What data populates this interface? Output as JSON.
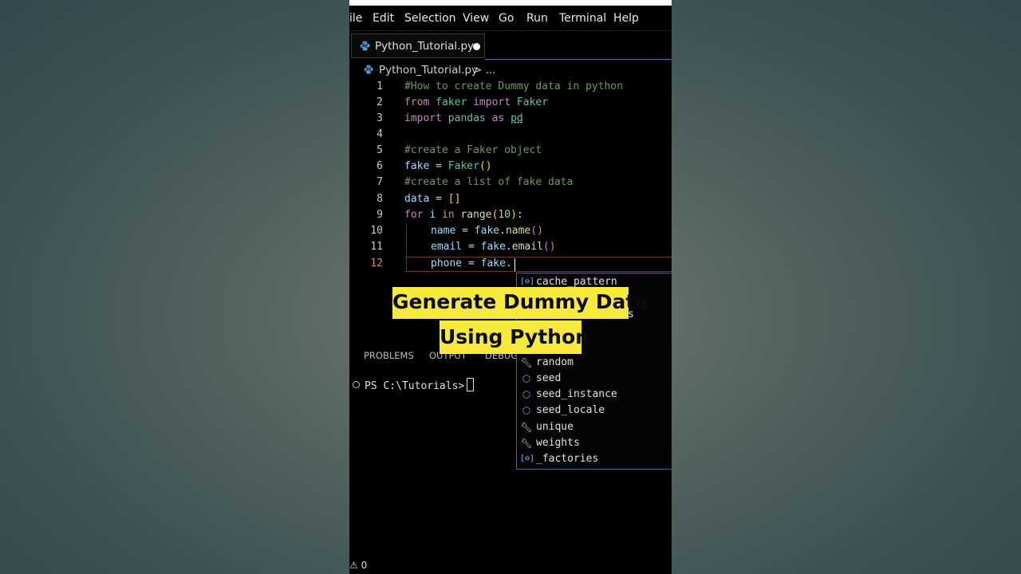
{
  "menu": [
    "ile",
    "Edit",
    "Selection",
    "View",
    "Go",
    "Run",
    "Terminal",
    "Help"
  ],
  "tab": {
    "label": "Python_Tutorial.py",
    "icon": "python-icon"
  },
  "breadcrumb": {
    "file": "Python_Tutorial.py",
    "rest": "> ..."
  },
  "line_numbers": [
    "1",
    "2",
    "3",
    "4",
    "5",
    "6",
    "7",
    "8",
    "9",
    "10",
    "11",
    "12"
  ],
  "code": {
    "l1_comment": "#How to create Dummy data in python",
    "l2_from": "from",
    "l2_module": "faker",
    "l2_import": "import",
    "l2_name": "Faker",
    "l3_import": "import",
    "l3_module": "pandas",
    "l3_as": "as",
    "l3_alias": "pd",
    "l5_comment": "#create a Faker object",
    "l6_var": "fake",
    "l6_eq": " = ",
    "l6_cls": "Faker",
    "l6_paren": "()",
    "l7_comment": "#create a list of fake data",
    "l8_var": "data",
    "l8_eq": " = ",
    "l8_brackets": "[]",
    "l9_for": "for",
    "l9_i": "i",
    "l9_in": "in",
    "l9_fn": "range",
    "l9_open": "(",
    "l9_num": "10",
    "l9_close": ")",
    "l9_colon": ":",
    "l10_var": "name",
    "l10_eq": " = ",
    "l10_obj": "fake",
    "l10_dot": ".",
    "l10_fn": "name",
    "l10_paren": "()",
    "l11_var": "email",
    "l11_eq": " = ",
    "l11_obj": "fake",
    "l11_dot": ".",
    "l11_fn": "email",
    "l11_paren": "()",
    "l12_var": "phone",
    "l12_eq": " = ",
    "l12_obj": "fake",
    "l12_dot": "."
  },
  "suggestions": [
    {
      "label": "cache_pattern",
      "icon": "field-icon"
    },
    {
      "label": "random",
      "icon": "wrench-icon"
    },
    {
      "label": "seed",
      "icon": "method-icon"
    },
    {
      "label": "seed_instance",
      "icon": "method-icon"
    },
    {
      "label": "seed_locale",
      "icon": "method-icon"
    },
    {
      "label": "unique",
      "icon": "wrench-icon"
    },
    {
      "label": "weights",
      "icon": "wrench-icon"
    },
    {
      "label": "_factories",
      "icon": "field-icon"
    }
  ],
  "hidden_suggestion_fragment": "s",
  "panel_tabs": [
    "PROBLEMS",
    "OUTPUT",
    "DEBUG"
  ],
  "terminal": {
    "prompt": "PS C:\\Tutorials>"
  },
  "status": {
    "text": "⚠ 0"
  },
  "caption": {
    "line1": "Generate Dummy Data",
    "line2": "Using Python"
  },
  "colors": {
    "caption_bg": "#f7ea3c",
    "active_line_number": "#e5884f",
    "suggest_border": "#3f6d9a"
  }
}
